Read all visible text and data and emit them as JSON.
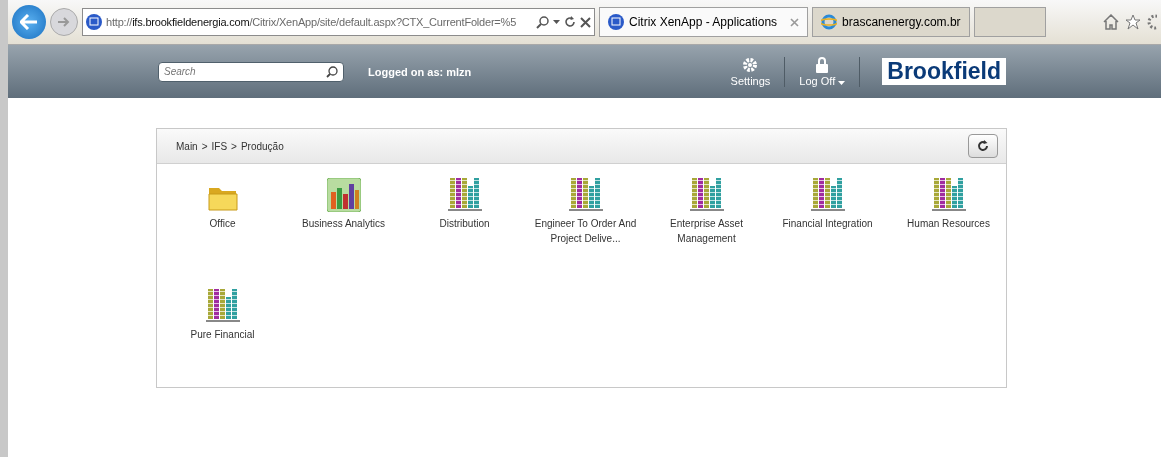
{
  "browser": {
    "address": {
      "prefix": "http://",
      "domain": "ifs.brookfieldenergia.com",
      "rest": "/Citrix/XenApp/site/default.aspx?CTX_CurrentFolder=%5"
    },
    "tabs": [
      {
        "label": "Citrix XenApp - Applications",
        "selected": true,
        "kind": "citrix"
      },
      {
        "label": "brascanenergy.com.br",
        "selected": false,
        "kind": "ie"
      }
    ]
  },
  "header": {
    "search": {
      "placeholder": "Search"
    },
    "logged_on": "Logged on as: mlzn",
    "settings": "Settings",
    "log_off": "Log Off",
    "logo": "Brookfield"
  },
  "breadcrumb": [
    {
      "label": "Main",
      "kind": "link"
    },
    {
      "label": ">",
      "kind": "separator"
    },
    {
      "label": "IFS",
      "kind": "link"
    },
    {
      "label": ">",
      "kind": "separator"
    },
    {
      "label": "Produção",
      "kind": "current"
    }
  ],
  "apps": [
    {
      "label": "Office",
      "kind": "folder"
    },
    {
      "label": "Business Analytics",
      "kind": "analytics"
    },
    {
      "label": "Distribution",
      "kind": "app"
    },
    {
      "label": "Engineer To Order And Project Delive...",
      "kind": "app"
    },
    {
      "label": "Enterprise Asset Management",
      "kind": "app"
    },
    {
      "label": "Financial Integration",
      "kind": "app"
    },
    {
      "label": "Human Resources",
      "kind": "app"
    },
    {
      "label": "Pure Financial",
      "kind": "app"
    }
  ]
}
